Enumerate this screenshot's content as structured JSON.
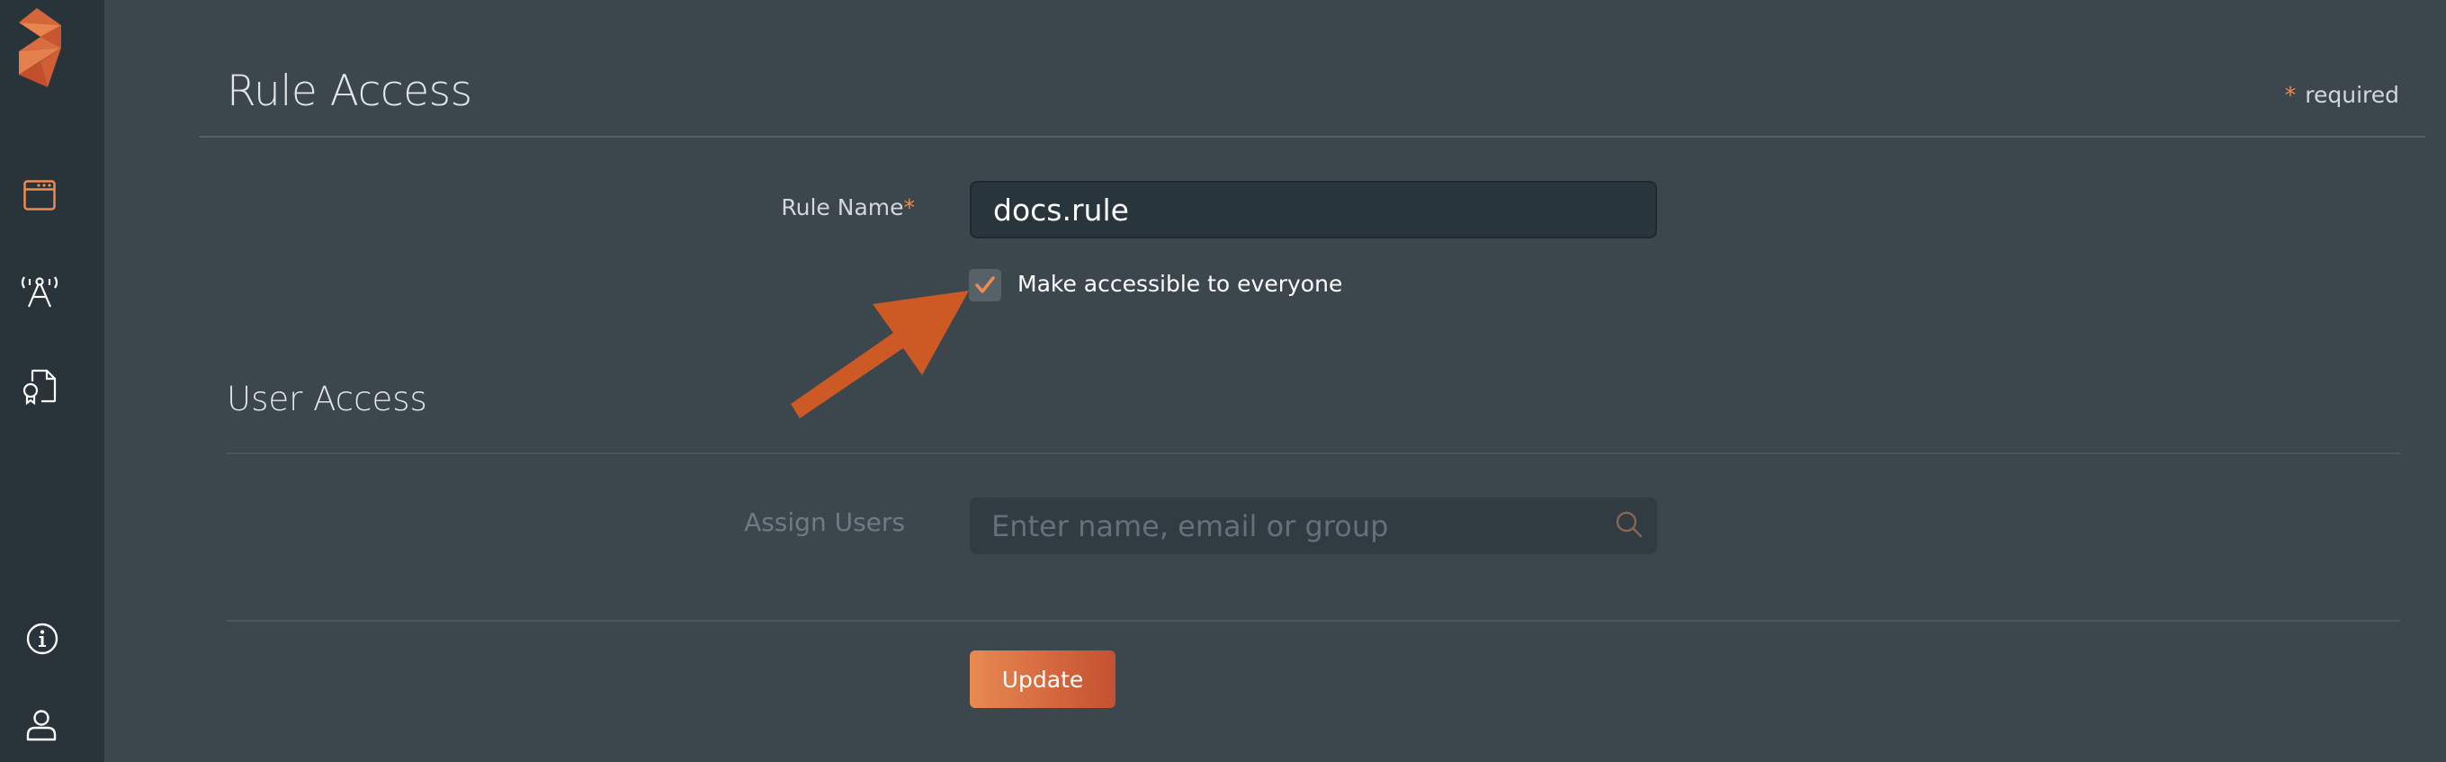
{
  "sidebar": {
    "logo": "app-logo",
    "items": [
      {
        "icon": "browser-window-icon",
        "label": "Applications",
        "active": true
      },
      {
        "icon": "antenna-icon",
        "label": "Connections",
        "active": false
      },
      {
        "icon": "certificate-icon",
        "label": "Certificates",
        "active": false
      }
    ],
    "bottom_items": [
      {
        "icon": "info-icon",
        "label": "Info"
      },
      {
        "icon": "user-icon",
        "label": "Account"
      }
    ]
  },
  "header": {
    "title": "Rule Access",
    "required_marker": "*",
    "required_text": "required"
  },
  "rule_form": {
    "rule_name_label": "Rule Name",
    "rule_name_required_marker": "*",
    "rule_name_value": "docs.rule",
    "accessible_checkbox_label": "Make accessible to everyone",
    "accessible_checked": true
  },
  "user_access": {
    "title": "User Access",
    "assign_label": "Assign Users",
    "assign_placeholder": "Enter name, email or group",
    "assign_value": ""
  },
  "actions": {
    "update_label": "Update"
  },
  "colors": {
    "accent": "#ef8a50",
    "arrow_annotation": "#cd5a24",
    "sidebar_bg": "#283439",
    "main_bg": "#3c464d"
  }
}
